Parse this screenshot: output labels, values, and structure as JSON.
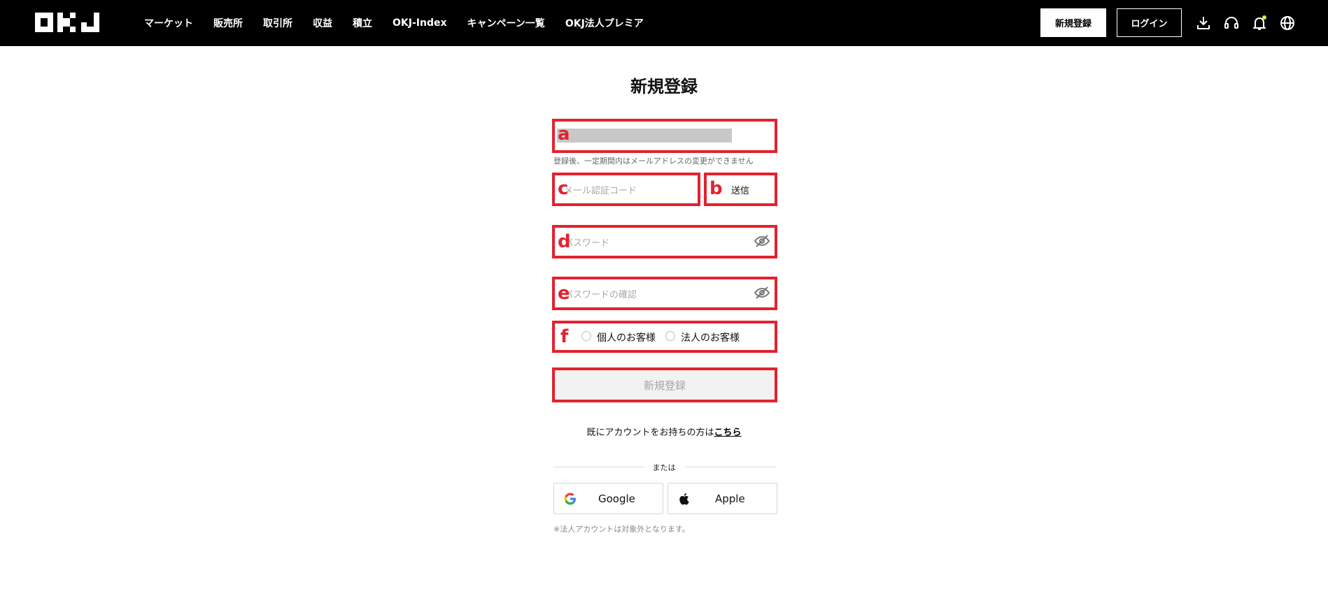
{
  "header": {
    "logo_text": "OKJ",
    "nav": [
      "マーケット",
      "販売所",
      "取引所",
      "収益",
      "積立",
      "OKJ-Index",
      "キャンペーン一覧",
      "OKJ法人プレミア"
    ],
    "register_label": "新規登録",
    "login_label": "ログイン",
    "icons": [
      "download-icon",
      "headset-icon",
      "bell-icon",
      "globe-icon"
    ],
    "notification_color": "#c6f24e"
  },
  "form": {
    "title": "新規登録",
    "email_hint": "登録後、一定期間内はメールアドレスの変更ができません",
    "code_placeholder": "メール認証コード",
    "send_label": "送信",
    "password_placeholder": "パスワード",
    "password_confirm_placeholder": "パスワードの確認",
    "radio_individual": "個人のお客様",
    "radio_corporate": "法人のお客様",
    "submit_label": "新規登録",
    "existing_prompt": "既にアカウントをお持ちの方は",
    "existing_link": "こちら",
    "or_label": "または",
    "google_label": "Google",
    "apple_label": "Apple",
    "note": "※法人アカウントは対象外となります。"
  },
  "annotations": {
    "a": "a",
    "b": "b",
    "c": "c",
    "d": "d",
    "e": "e",
    "f": "f",
    "color": "#e3222e"
  }
}
